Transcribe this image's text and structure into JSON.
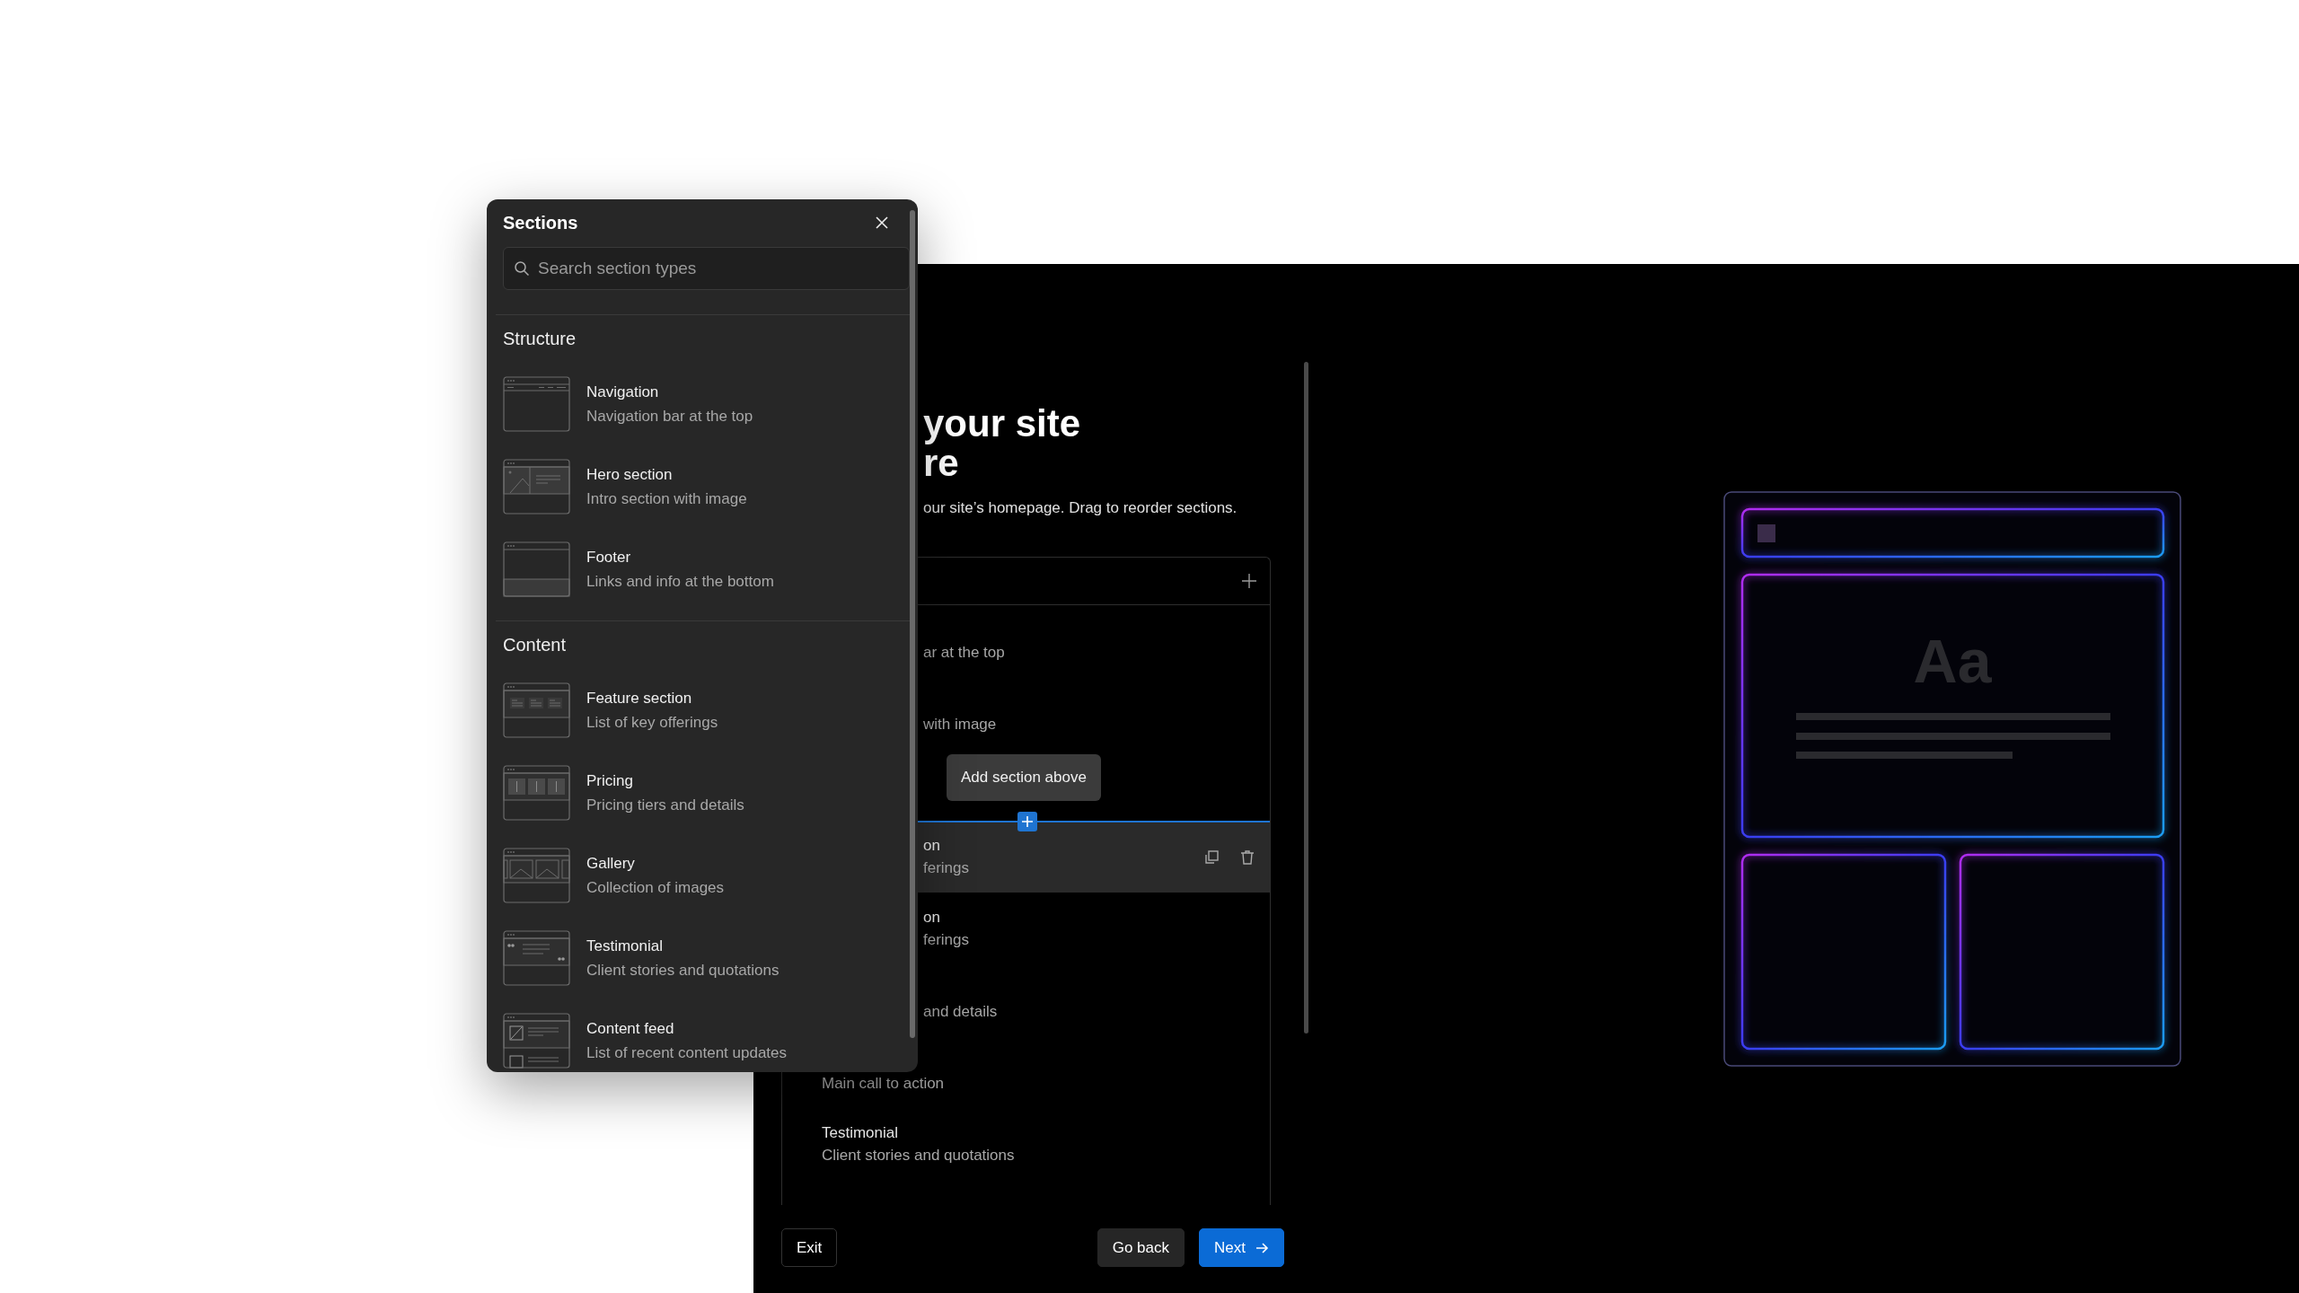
{
  "panel": {
    "title": "Sections",
    "search": {
      "placeholder": "Search section types"
    },
    "groups": [
      {
        "heading": "Structure",
        "items": [
          {
            "kind": "navigation",
            "title": "Navigation",
            "description": "Navigation bar at the top"
          },
          {
            "kind": "hero",
            "title": "Hero section",
            "description": "Intro section with image"
          },
          {
            "kind": "footer",
            "title": "Footer",
            "description": "Links and info at the bottom"
          }
        ]
      },
      {
        "heading": "Content",
        "items": [
          {
            "kind": "feature",
            "title": "Feature section",
            "description": "List of key offerings"
          },
          {
            "kind": "pricing",
            "title": "Pricing",
            "description": "Pricing tiers and details"
          },
          {
            "kind": "gallery",
            "title": "Gallery",
            "description": "Collection of images"
          },
          {
            "kind": "testimonial",
            "title": "Testimonial",
            "description": "Client stories and quotations"
          },
          {
            "kind": "feed",
            "title": "Content feed",
            "description": "List of recent content updates"
          }
        ]
      }
    ]
  },
  "page": {
    "heading_lines": [
      "your site",
      "re"
    ],
    "subtitle": "our site’s homepage. Drag to reorder sections.",
    "list": {
      "tooltip": "Add section above",
      "rows": [
        {
          "kind": "clipped",
          "description": "ar at the top",
          "hovered": false
        },
        {
          "kind": "clipped",
          "description": "with image",
          "hovered": false
        },
        {
          "kind": "covered",
          "hovered": false
        },
        {
          "kind": "clipped",
          "title": "on",
          "description": "ferings",
          "hovered": true
        },
        {
          "kind": "clipped",
          "title": "on",
          "description": "ferings",
          "hovered": false
        },
        {
          "kind": "clipped",
          "description": "and details",
          "hovered": false
        },
        {
          "kind": "full",
          "description": "Main call to action",
          "hovered": false
        },
        {
          "kind": "full",
          "title": "Testimonial",
          "description": "Client stories and quotations",
          "hovered": false
        }
      ]
    },
    "buttons": [
      {
        "kind": "outline",
        "label": "Exit"
      },
      {
        "kind": "neutral",
        "label": "Go back"
      },
      {
        "kind": "primary",
        "label": "Next"
      }
    ]
  },
  "illustration": {
    "sample_text": "Aa"
  }
}
